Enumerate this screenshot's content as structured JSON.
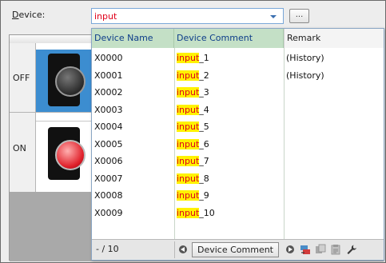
{
  "device": {
    "label_underlined": "D",
    "label_rest": "evice:",
    "input_value": "input",
    "browse_label": "..."
  },
  "states": {
    "off_label": "OFF",
    "on_label": "ON"
  },
  "dropdown": {
    "columns": {
      "name": "Device Name",
      "comment": "Device Comment",
      "remark": "Remark"
    },
    "highlight_term": "input",
    "rows": [
      {
        "name": "X0000",
        "comment_suffix": "_1",
        "remark": "(History)"
      },
      {
        "name": "X0001",
        "comment_suffix": "_2",
        "remark": "(History)"
      },
      {
        "name": "X0002",
        "comment_suffix": "_3",
        "remark": ""
      },
      {
        "name": "X0003",
        "comment_suffix": "_4",
        "remark": ""
      },
      {
        "name": "X0004",
        "comment_suffix": "_5",
        "remark": ""
      },
      {
        "name": "X0005",
        "comment_suffix": "_6",
        "remark": ""
      },
      {
        "name": "X0006",
        "comment_suffix": "_7",
        "remark": ""
      },
      {
        "name": "X0007",
        "comment_suffix": "_8",
        "remark": ""
      },
      {
        "name": "X0008",
        "comment_suffix": "_9",
        "remark": ""
      },
      {
        "name": "X0009",
        "comment_suffix": "_10",
        "remark": ""
      }
    ],
    "footer": {
      "count": "- / 10",
      "device_comment_button": "Device Comment"
    }
  },
  "colors": {
    "highlight_bg": "#fff200",
    "highlight_text": "#e0001b",
    "header_green": "#c4e0c6",
    "header_text": "#0d3d89",
    "lamp_on": "#e0202a",
    "off_panel_blue": "#3c8dd0"
  },
  "icons": [
    "caret-down-icon",
    "previous-icon",
    "next-icon",
    "transfer-icon",
    "copy-icon",
    "paste-icon",
    "settings-wrench-icon"
  ]
}
